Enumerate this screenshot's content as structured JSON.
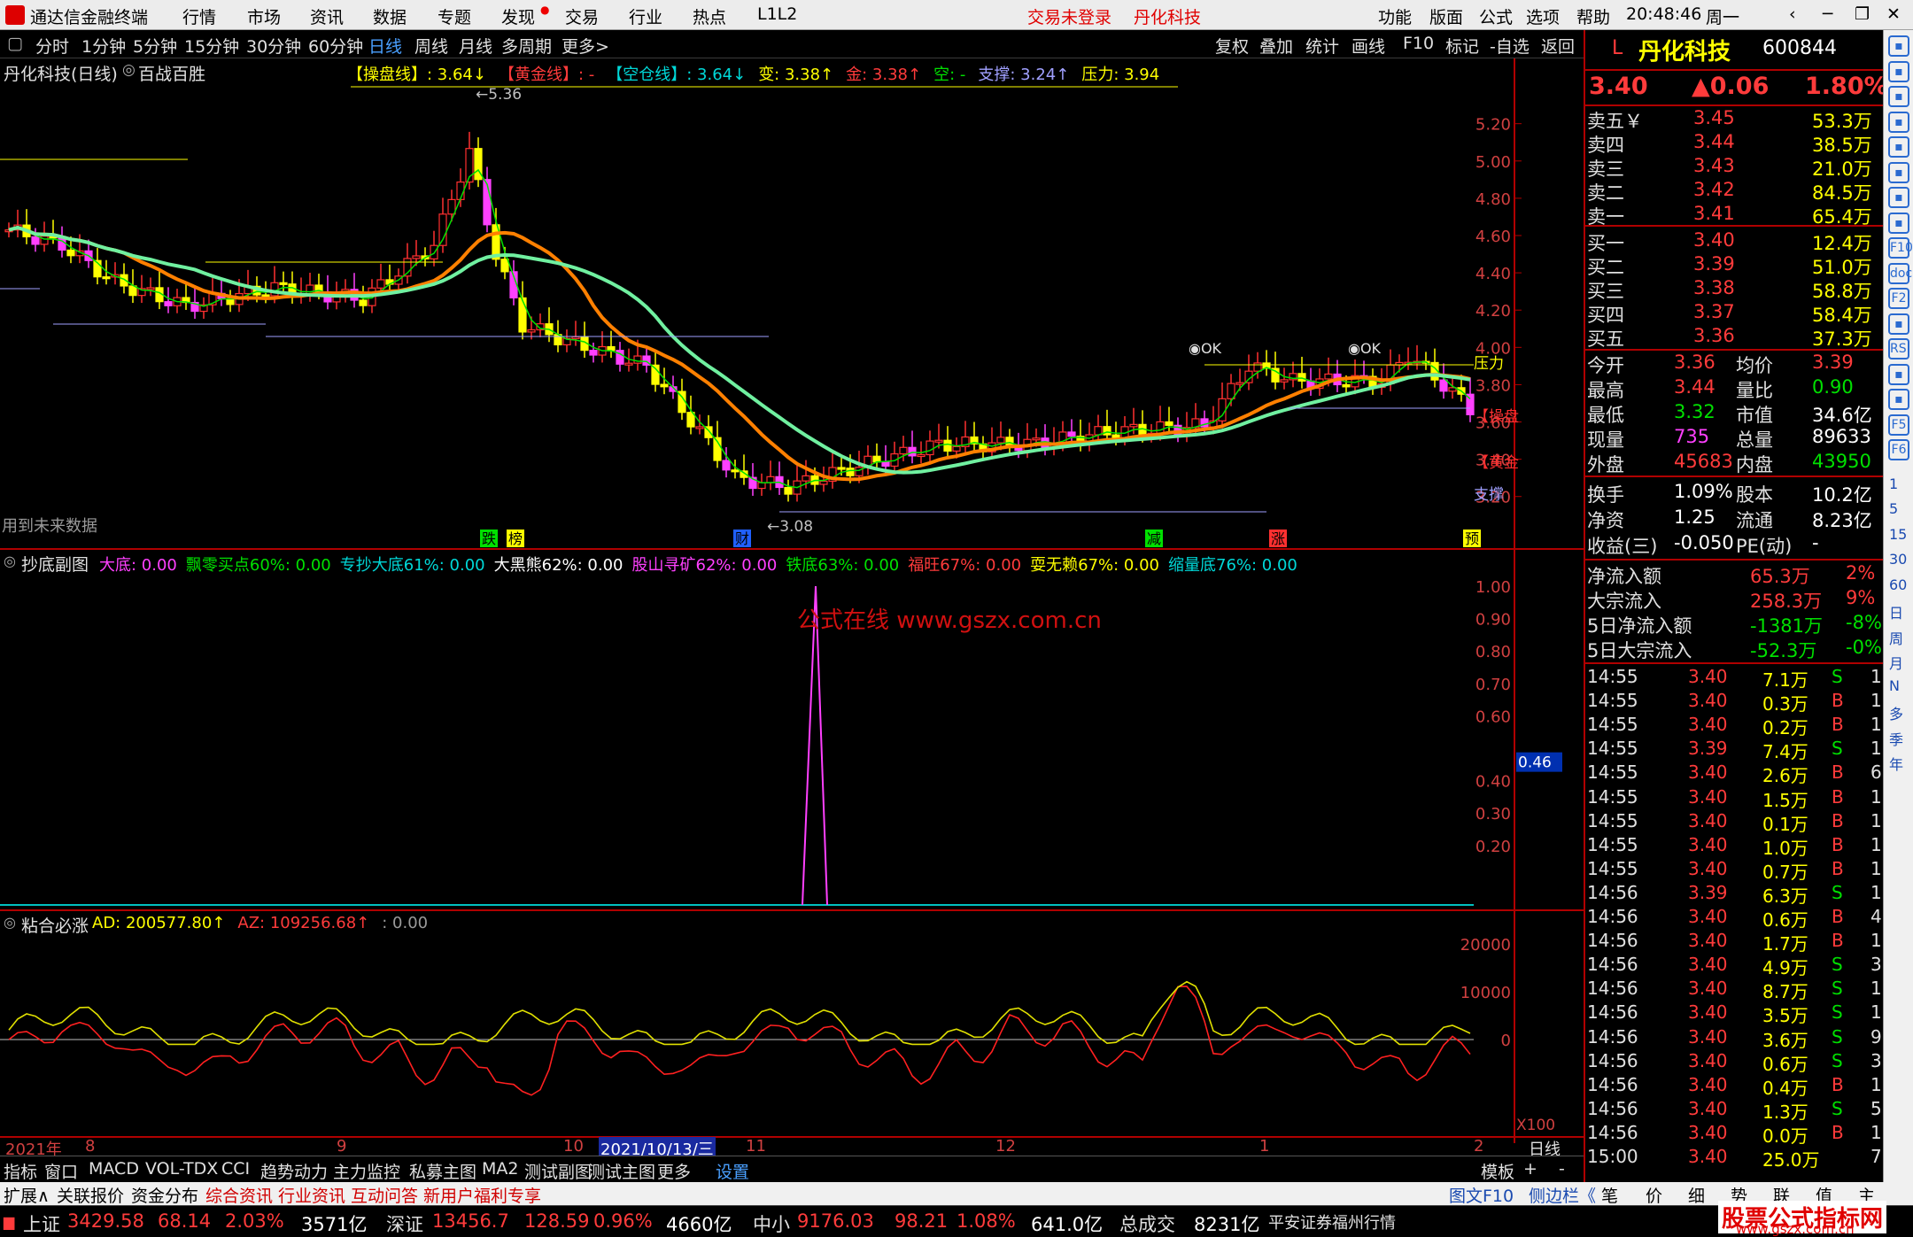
{
  "app": {
    "title": "通达信金融终端",
    "menus": [
      "行情",
      "市场",
      "资讯",
      "数据",
      "专题",
      "发现",
      "交易",
      "行业",
      "热点",
      "L1L2"
    ],
    "login_status": "交易未登录",
    "stock_title": "丹化科技",
    "right_menus": [
      "功能",
      "版面",
      "公式",
      "选项",
      "帮助"
    ],
    "clock": "20:48:46",
    "weekday": "周一"
  },
  "toolbar": {
    "periods": [
      "分时",
      "1分钟",
      "5分钟",
      "15分钟",
      "30分钟",
      "60分钟",
      "日线",
      "周线",
      "月线",
      "多周期",
      "更多>"
    ],
    "active_period": "日线",
    "tools": [
      "复权",
      "叠加",
      "统计",
      "画线",
      "F10",
      "标记",
      "-自选",
      "返回"
    ]
  },
  "main_chart": {
    "name": "丹化科技(日线)",
    "formula": "百战百胜",
    "indicators": [
      {
        "label": "【操盘线】: 3.64↓",
        "color": "#ffff00"
      },
      {
        "label": "【黄金线】: -",
        "color": "#ff3b3b"
      },
      {
        "label": "【空仓线】: 3.64↓",
        "color": "#00d8d8"
      },
      {
        "label": "变: 3.38↑",
        "color": "#ffff00"
      },
      {
        "label": "金: 3.38↑",
        "color": "#ff3b3b"
      },
      {
        "label": "空: -",
        "color": "#00e000"
      },
      {
        "label": "支撑: 3.24↑",
        "color": "#a0a0ff"
      },
      {
        "label": "压力: 3.94",
        "color": "#ffff00"
      }
    ],
    "price_axis": [
      "5.20",
      "5.00",
      "4.80",
      "4.60",
      "4.40",
      "4.20",
      "4.00",
      "3.80",
      "3.60",
      "3.40",
      "3.20"
    ],
    "high_label": "5.36",
    "low_label": "3.08",
    "footnote": "用到未来数据",
    "ok_label": "OK",
    "right_labels": [
      "压力",
      "【操盘",
      "【黄金",
      "支撑"
    ],
    "signals": [
      "跌",
      "榜",
      "财",
      "减",
      "涨",
      "预"
    ]
  },
  "sub1": {
    "name": "抄底副图",
    "items": [
      {
        "label": "大底: 0.00",
        "color": "#ff40ff"
      },
      {
        "label": "飘零买点60%: 0.00",
        "color": "#00e000"
      },
      {
        "label": "专抄大底61%: 0.00",
        "color": "#00d8d8"
      },
      {
        "label": "大黑熊62%: 0.00",
        "color": "#ffffff"
      },
      {
        "label": "股山寻矿62%: 0.00",
        "color": "#ff40ff"
      },
      {
        "label": "铁底63%: 0.00",
        "color": "#00e000"
      },
      {
        "label": "福旺67%: 0.00",
        "color": "#ff3b3b"
      },
      {
        "label": "耍无赖67%: 0.00",
        "color": "#ffff00"
      },
      {
        "label": "缩量底76%: 0.00",
        "color": "#00d8d8"
      }
    ],
    "axis": [
      "1.00",
      "0.90",
      "0.80",
      "0.70",
      "0.60",
      "0.50",
      "0.40",
      "0.30",
      "0.20"
    ],
    "cursor_value": "0.46",
    "watermark": "公式在线  www.gszx.com.cn"
  },
  "sub2": {
    "name": "粘合必涨",
    "items": [
      {
        "label": "AD: 200577.80↑",
        "color": "#ffff00"
      },
      {
        "label": "AZ: 109256.68↑",
        "color": "#ff3b3b"
      },
      {
        "label": ": 0.00",
        "color": "#9a9a9a"
      }
    ],
    "axis": [
      "20000",
      "10000",
      "0"
    ],
    "multiplier": "X100"
  },
  "date_axis": {
    "labels": [
      "2021年",
      "8",
      "9",
      "10",
      "2021/10/13/三",
      "11",
      "12",
      "1",
      "2"
    ],
    "period": "日线"
  },
  "bottom_tabs": [
    "指标",
    "窗口",
    "MACD",
    "VOL-TDX",
    "CCI",
    "趋势动力",
    "主力监控",
    "私募主图",
    "MA2",
    "测试副图",
    "测试主图",
    "更多",
    "设置"
  ],
  "bottom_right": [
    "模板",
    "+",
    "-"
  ],
  "news_tabs": [
    "扩展∧",
    "关联报价",
    "资金分布",
    "综合资讯",
    "行业资讯",
    "互动问答",
    "新用户福利专享"
  ],
  "news_right": [
    "图文F10",
    "侧边栏《"
  ],
  "quote": {
    "prefix": "L",
    "name": "丹化科技",
    "code": "600844",
    "price": "3.40",
    "change": "▲0.06",
    "pct": "1.80%",
    "asks": [
      {
        "label": "卖五￥",
        "price": "3.45",
        "vol": "53.3万"
      },
      {
        "label": "卖四",
        "price": "3.44",
        "vol": "38.5万"
      },
      {
        "label": "卖三",
        "price": "3.43",
        "vol": "21.0万"
      },
      {
        "label": "卖二",
        "price": "3.42",
        "vol": "84.5万"
      },
      {
        "label": "卖一",
        "price": "3.41",
        "vol": "65.4万"
      }
    ],
    "bids": [
      {
        "label": "买一",
        "price": "3.40",
        "vol": "12.4万"
      },
      {
        "label": "买二",
        "price": "3.39",
        "vol": "51.0万"
      },
      {
        "label": "买三",
        "price": "3.38",
        "vol": "58.8万"
      },
      {
        "label": "买四",
        "price": "3.37",
        "vol": "58.4万"
      },
      {
        "label": "买五",
        "price": "3.36",
        "vol": "37.3万"
      }
    ],
    "stats1": [
      {
        "l1": "今开",
        "v1": "3.36",
        "c1": "#ff3b3b",
        "l2": "均价",
        "v2": "3.39",
        "c2": "#ff3b3b"
      },
      {
        "l1": "最高",
        "v1": "3.44",
        "c1": "#ff3b3b",
        "l2": "量比",
        "v2": "0.90",
        "c2": "#00e000"
      },
      {
        "l1": "最低",
        "v1": "3.32",
        "c1": "#00e000",
        "l2": "市值",
        "v2": "34.6亿",
        "c2": "#ffffff"
      },
      {
        "l1": "现量",
        "v1": "735",
        "c1": "#ff40ff",
        "l2": "总量",
        "v2": "89633",
        "c2": "#ffffff"
      },
      {
        "l1": "外盘",
        "v1": "45683",
        "c1": "#ff3b3b",
        "l2": "内盘",
        "v2": "43950",
        "c2": "#00e000"
      }
    ],
    "stats2": [
      {
        "l1": "换手",
        "v1": "1.09%",
        "l2": "股本",
        "v2": "10.2亿"
      },
      {
        "l1": "净资",
        "v1": "1.25",
        "l2": "流通",
        "v2": "8.23亿"
      },
      {
        "l1": "收益(三)",
        "v1": "-0.050",
        "l2": "PE(动)",
        "v2": "-"
      }
    ],
    "flows": [
      {
        "label": "净流入额",
        "val": "65.3万",
        "pct": "2%",
        "color": "#ff3b3b"
      },
      {
        "label": "大宗流入",
        "val": "258.3万",
        "pct": "9%",
        "color": "#ff3b3b"
      },
      {
        "label": "5日净流入额",
        "val": "-1381万",
        "pct": "-8%",
        "color": "#00e000"
      },
      {
        "label": "5日大宗流入",
        "val": "-52.3万",
        "pct": "-0%",
        "color": "#00e000"
      }
    ],
    "ticks": [
      {
        "t": "14:55",
        "p": "3.40",
        "v": "7.1万",
        "d": "S",
        "n": "11"
      },
      {
        "t": "14:55",
        "p": "3.40",
        "v": "0.3万",
        "d": "B",
        "n": "1"
      },
      {
        "t": "14:55",
        "p": "3.40",
        "v": "0.2万",
        "d": "B",
        "n": "1"
      },
      {
        "t": "14:55",
        "p": "3.39",
        "v": "7.4万",
        "d": "S",
        "n": "1"
      },
      {
        "t": "14:55",
        "p": "3.40",
        "v": "2.6万",
        "d": "B",
        "n": "6"
      },
      {
        "t": "14:55",
        "p": "3.40",
        "v": "1.5万",
        "d": "B",
        "n": "1"
      },
      {
        "t": "14:55",
        "p": "3.40",
        "v": "0.1万",
        "d": "B",
        "n": "1"
      },
      {
        "t": "14:55",
        "p": "3.40",
        "v": "1.0万",
        "d": "B",
        "n": "1"
      },
      {
        "t": "14:55",
        "p": "3.40",
        "v": "0.7万",
        "d": "B",
        "n": "1"
      },
      {
        "t": "14:56",
        "p": "3.39",
        "v": "6.3万",
        "d": "S",
        "n": "1"
      },
      {
        "t": "14:56",
        "p": "3.40",
        "v": "0.6万",
        "d": "B",
        "n": "4"
      },
      {
        "t": "14:56",
        "p": "3.40",
        "v": "1.7万",
        "d": "B",
        "n": "12"
      },
      {
        "t": "14:56",
        "p": "3.40",
        "v": "4.9万",
        "d": "S",
        "n": "3"
      },
      {
        "t": "14:56",
        "p": "3.40",
        "v": "8.7万",
        "d": "S",
        "n": "10"
      },
      {
        "t": "14:56",
        "p": "3.40",
        "v": "3.5万",
        "d": "S",
        "n": "10"
      },
      {
        "t": "14:56",
        "p": "3.40",
        "v": "3.6万",
        "d": "S",
        "n": "9"
      },
      {
        "t": "14:56",
        "p": "3.40",
        "v": "0.6万",
        "d": "S",
        "n": "3"
      },
      {
        "t": "14:56",
        "p": "3.40",
        "v": "0.4万",
        "d": "B",
        "n": "1"
      },
      {
        "t": "14:56",
        "p": "3.40",
        "v": "1.3万",
        "d": "S",
        "n": "5"
      },
      {
        "t": "14:56",
        "p": "3.40",
        "v": "0.0万",
        "d": "B",
        "n": "1"
      },
      {
        "t": "15:00",
        "p": "3.40",
        "v": "25.0万",
        "d": "",
        "n": "77"
      }
    ],
    "bottom_tabs": [
      "笔",
      "价",
      "细",
      "势",
      "联",
      "值",
      "主"
    ]
  },
  "side_icons": [
    "arrow-left",
    "arrow-up",
    "arrow-down",
    "chart",
    "list",
    "line",
    "kline",
    "table",
    "F10",
    "doc",
    "F2",
    "clock",
    "RSI",
    "move",
    "edit",
    "F5",
    "F6",
    "1",
    "5",
    "15",
    "30",
    "60",
    "日",
    "周",
    "月",
    "N",
    "多",
    "季",
    "年"
  ],
  "statusbar": {
    "indices": [
      {
        "name": "上证",
        "val": "3429.58",
        "chg": "68.14",
        "pct": "2.03%",
        "amt": "3571亿"
      },
      {
        "name": "深证",
        "val": "13456.7",
        "chg": "128.59",
        "pct": "0.96%",
        "amt": "4660亿"
      },
      {
        "name": "中小",
        "val": "9176.03",
        "chg": "98.21",
        "pct": "1.08%",
        "amt": "641.0亿"
      }
    ],
    "total_label": "总成交",
    "total_val": "8231亿",
    "broker": "平安证券福州行情",
    "site_logo": "股票公式指标网",
    "site_url": "www.gszx.com.cn"
  },
  "chart_data": {
    "type": "candlestick",
    "price_range": [
      3.08,
      5.36
    ],
    "high": 5.36,
    "low": 3.08,
    "support": 3.24,
    "pressure": 3.94,
    "operation_line": 3.64,
    "empty_line": 3.64,
    "sub1_spike": 1.0,
    "sub2_range": [
      -10000,
      20000
    ]
  }
}
